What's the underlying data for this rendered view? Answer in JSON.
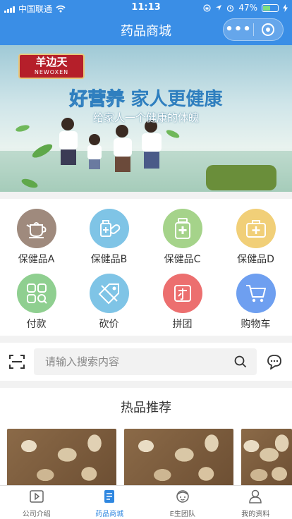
{
  "status_bar": {
    "carrier": "中国联通",
    "time": "11:13",
    "battery": "47%"
  },
  "nav": {
    "title": "药品商城",
    "more_icon": "more-dots-icon",
    "close_icon": "target-close-icon"
  },
  "banner": {
    "logo_cn": "羊边天",
    "logo_en": "NEWOXEN",
    "slogan_part1": "好营养",
    "slogan_part2": "家人更健康",
    "sub_slogan": "给家人一个健康的体魄"
  },
  "categories": [
    {
      "label": "保健品A",
      "icon": "teapot-icon",
      "color": "#9f8a7d"
    },
    {
      "label": "保健品B",
      "icon": "pills-icon",
      "color": "#7fc4e6"
    },
    {
      "label": "保健品C",
      "icon": "medicine-bottle-icon",
      "color": "#a5d38a"
    },
    {
      "label": "保健品D",
      "icon": "medical-kit-icon",
      "color": "#f1cf78"
    },
    {
      "label": "付款",
      "icon": "grid-apps-icon",
      "color": "#8fcf90"
    },
    {
      "label": "砍价",
      "icon": "price-tag-icon",
      "color": "#7fc4e6"
    },
    {
      "label": "拼团",
      "icon": "group-buy-icon",
      "color": "#ec6f6f"
    },
    {
      "label": "购物车",
      "icon": "cart-icon",
      "color": "#6e9ff0"
    }
  ],
  "search": {
    "placeholder": "请输入搜索内容"
  },
  "hot": {
    "title": "热品推荐"
  },
  "tabs": [
    {
      "label": "公司介绍",
      "icon": "video-icon",
      "active": false
    },
    {
      "label": "药品商城",
      "icon": "document-icon",
      "active": true
    },
    {
      "label": "E生团队",
      "icon": "person-face-icon",
      "active": false
    },
    {
      "label": "我的资料",
      "icon": "user-icon",
      "active": false
    }
  ]
}
